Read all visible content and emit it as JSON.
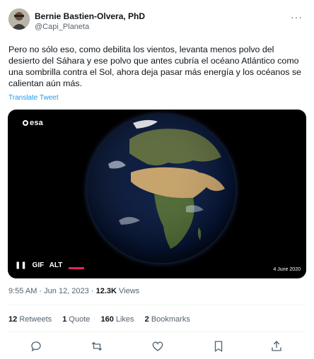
{
  "author": {
    "name": "Bernie Bastien-Olvera, PhD",
    "handle": "@Capi_Planeta"
  },
  "tweet": {
    "text": "Pero no sólo eso, como debilita los vientos, levanta menos polvo del desierto del Sáhara y ese polvo que antes cubría el océano Atlántico como una sombrilla contra el Sol, ahora deja pasar más energía y los océanos se calientan aún más.",
    "translate_label": "Translate Tweet"
  },
  "media": {
    "logo": "esa",
    "pause_icon": "pause-icon",
    "gif_badge": "GIF",
    "alt_badge": "ALT",
    "date_overlay": "4 June 2020"
  },
  "meta": {
    "time": "9:55 AM",
    "date": "Jun 12, 2023",
    "views_count": "12.3K",
    "views_label": "Views"
  },
  "stats": {
    "retweets_count": "12",
    "retweets_label": "Retweets",
    "quotes_count": "1",
    "quotes_label": "Quote",
    "likes_count": "160",
    "likes_label": "Likes",
    "bookmarks_count": "2",
    "bookmarks_label": "Bookmarks"
  },
  "actions": [
    "reply-icon",
    "retweet-icon",
    "like-icon",
    "bookmark-icon",
    "share-icon"
  ],
  "colors": {
    "link": "#1d9bf0",
    "secondary_text": "#536471",
    "primary_text": "#0f1419",
    "progress": "#e0245e"
  }
}
